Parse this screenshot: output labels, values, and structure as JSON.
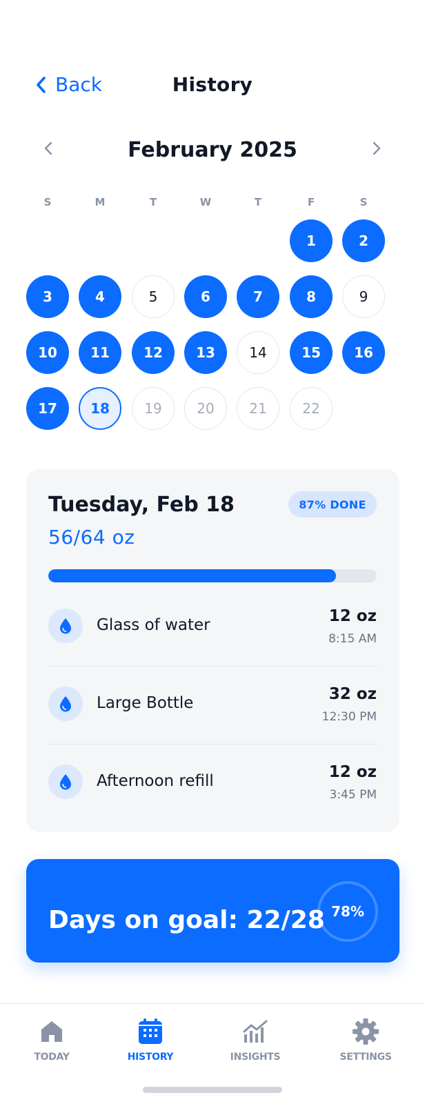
{
  "header": {
    "back_label": "Back",
    "title": "History"
  },
  "calendar": {
    "month_label": "February 2025",
    "weekdays": [
      "S",
      "M",
      "T",
      "W",
      "T",
      "F",
      "S"
    ],
    "days": [
      {
        "label": "1",
        "status": "goal"
      },
      {
        "label": "2",
        "status": "goal"
      },
      {
        "label": "3",
        "status": "goal"
      },
      {
        "label": "4",
        "status": "goal"
      },
      {
        "label": "5",
        "status": "missed"
      },
      {
        "label": "6",
        "status": "goal"
      },
      {
        "label": "7",
        "status": "goal"
      },
      {
        "label": "8",
        "status": "goal"
      },
      {
        "label": "9",
        "status": "missed"
      },
      {
        "label": "10",
        "status": "goal"
      },
      {
        "label": "11",
        "status": "goal"
      },
      {
        "label": "12",
        "status": "goal"
      },
      {
        "label": "13",
        "status": "goal"
      },
      {
        "label": "14",
        "status": "missed"
      },
      {
        "label": "15",
        "status": "goal"
      },
      {
        "label": "16",
        "status": "goal"
      },
      {
        "label": "17",
        "status": "goal"
      },
      {
        "label": "18",
        "status": "selected"
      },
      {
        "label": "19",
        "status": "future"
      },
      {
        "label": "20",
        "status": "future"
      },
      {
        "label": "21",
        "status": "future"
      },
      {
        "label": "22",
        "status": "future"
      }
    ]
  },
  "day_detail": {
    "date": "Tuesday, Feb 18",
    "total": "56/64 oz",
    "badge": "87% DONE",
    "progress": 0.875,
    "entries": [
      {
        "name": "Glass of water",
        "amount": "12 oz",
        "time": "8:15 AM",
        "icon": "water-drop-icon"
      },
      {
        "name": "Large Bottle",
        "amount": "32 oz",
        "time": "12:30 PM",
        "icon": "water-drop-icon"
      },
      {
        "name": "Afternoon refill",
        "amount": "12 oz",
        "time": "3:45 PM",
        "icon": "water-drop-icon"
      }
    ]
  },
  "goal_summary": {
    "text": "Days on goal: 22/28",
    "percent_label": "78%",
    "percent": 0.78
  },
  "nav": {
    "items": [
      {
        "label": "TODAY",
        "icon": "home-icon",
        "active": false
      },
      {
        "label": "HISTORY",
        "icon": "calendar-icon",
        "active": true
      },
      {
        "label": "INSIGHTS",
        "icon": "chart-icon",
        "active": false
      },
      {
        "label": "SETTINGS",
        "icon": "gear-icon",
        "active": false
      }
    ]
  },
  "colors": {
    "accent": "#0B6CFF",
    "card_bg": "#F4F6F8",
    "muted": "#8A94A6",
    "badge_bg": "#D7E6FD"
  }
}
